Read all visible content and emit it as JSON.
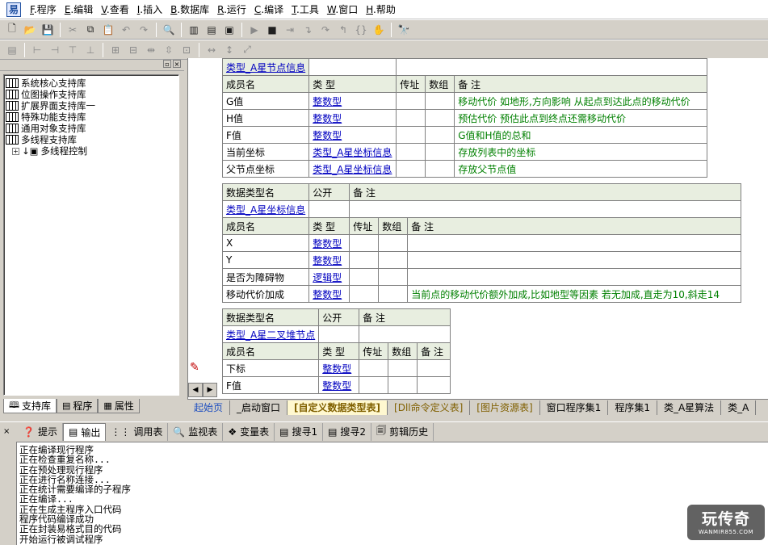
{
  "menu": [
    {
      "key": "F",
      "label": ".程序"
    },
    {
      "key": "E",
      "label": ".编辑"
    },
    {
      "key": "V",
      "label": ".查看"
    },
    {
      "key": "I",
      "label": ".插入"
    },
    {
      "key": "B",
      "label": ".数据库"
    },
    {
      "key": "R",
      "label": ".运行"
    },
    {
      "key": "C",
      "label": ".编译"
    },
    {
      "key": "T",
      "label": ".工具"
    },
    {
      "key": "W",
      "label": ".窗口"
    },
    {
      "key": "H",
      "label": ".帮助"
    }
  ],
  "tree": {
    "items": [
      "系统核心支持库",
      "位图操作支持库",
      "扩展界面支持库一",
      "特殊功能支持库",
      "通用对象支持库",
      "多线程支持库"
    ],
    "child": "多线程控制"
  },
  "left_tabs": [
    "支持库",
    "程序",
    "属性"
  ],
  "table1": {
    "name": "类型_A星节点信息",
    "headers": [
      "成员名",
      "类 型",
      "传址",
      "数组",
      "备 注"
    ],
    "rows": [
      {
        "name": "G值",
        "type": "整数型",
        "note": "移动代价 如地形,方向影响  从起点到达此点的移动代价"
      },
      {
        "name": "H值",
        "type": "整数型",
        "note": "预估代价 预估此点到终点还需移动代价"
      },
      {
        "name": "F值",
        "type": "整数型",
        "note": "G值和H值的总和"
      },
      {
        "name": "当前坐标",
        "type": "类型_A星坐标信息",
        "note": "存放列表中的坐标"
      },
      {
        "name": "父节点坐标",
        "type": "类型_A星坐标信息",
        "note": "存放父节点值"
      }
    ]
  },
  "table2": {
    "top_headers": [
      "数据类型名",
      "公开",
      "备 注"
    ],
    "name": "类型_A星坐标信息",
    "headers": [
      "成员名",
      "类 型",
      "传址",
      "数组",
      "备 注"
    ],
    "rows": [
      {
        "name": "X",
        "type": "整数型",
        "note": ""
      },
      {
        "name": "Y",
        "type": "整数型",
        "note": ""
      },
      {
        "name": "是否为障碍物",
        "type": "逻辑型",
        "note": ""
      },
      {
        "name": "移动代价加成",
        "type": "整数型",
        "note": "当前点的移动代价额外加成,比如地型等因素    若无加成,直走为10,斜走14"
      }
    ]
  },
  "table3": {
    "top_headers": [
      "数据类型名",
      "公开",
      "备 注"
    ],
    "name": "类型_A星二叉堆节点",
    "headers": [
      "成员名",
      "类 型",
      "传址",
      "数组",
      "备 注"
    ],
    "rows": [
      {
        "name": "下标",
        "type": "整数型",
        "note": ""
      },
      {
        "name": "F值",
        "type": "整数型",
        "note": ""
      }
    ]
  },
  "editor_tabs": [
    "起始页",
    "_启动窗口",
    "[自定义数据类型表]",
    "[Dll命令定义表]",
    "[图片资源表]",
    "窗口程序集1",
    "程序集1",
    "类_A星算法",
    "类_A"
  ],
  "output_tabs": [
    "提示",
    "输出",
    "调用表",
    "监视表",
    "变量表",
    "搜寻1",
    "搜寻2",
    "剪辑历史"
  ],
  "output_lines": [
    "正在编译现行程序",
    "正在检查重复名称...",
    "正在预处理现行程序",
    "正在进行名称连接...",
    "正在统计需要编译的子程序",
    "正在编译...",
    "正在生成主程序入口代码",
    "程序代码编译成功",
    "正在封装易格式目的代码",
    "开始运行被调试程序"
  ],
  "watermark": {
    "title": "玩传奇",
    "sub": "WANMIR855.COM"
  },
  "colors": {
    "link": "#0000c0",
    "comment": "#008000",
    "header_bg": "#e8eee0"
  }
}
